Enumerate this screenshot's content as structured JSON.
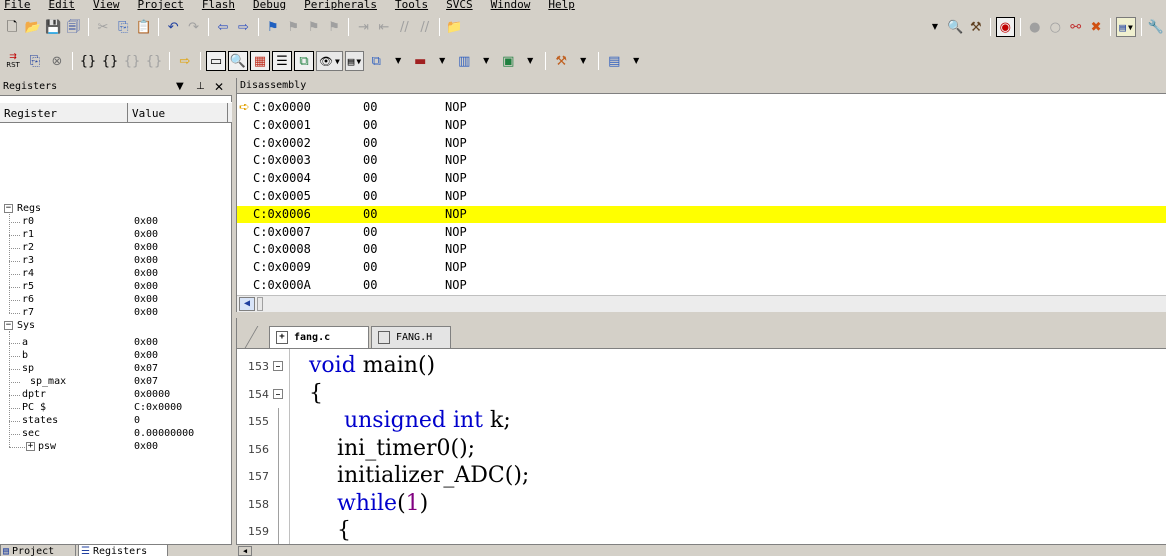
{
  "menu": [
    "File",
    "Edit",
    "View",
    "Project",
    "Flash",
    "Debug",
    "Peripherals",
    "Tools",
    "SVCS",
    "Window",
    "Help"
  ],
  "toolbar": {
    "reset_label": "RST",
    "inline_dropdown_label": "E"
  },
  "registers": {
    "title": "Registers",
    "col_register": "Register",
    "col_value": "Value",
    "regs_label": "Regs",
    "regs": [
      {
        "name": "r0",
        "value": "0x00"
      },
      {
        "name": "r1",
        "value": "0x00"
      },
      {
        "name": "r2",
        "value": "0x00"
      },
      {
        "name": "r3",
        "value": "0x00"
      },
      {
        "name": "r4",
        "value": "0x00"
      },
      {
        "name": "r5",
        "value": "0x00"
      },
      {
        "name": "r6",
        "value": "0x00"
      },
      {
        "name": "r7",
        "value": "0x00"
      }
    ],
    "sys_label": "Sys",
    "sys": [
      {
        "name": "a",
        "value": "0x00"
      },
      {
        "name": "b",
        "value": "0x00"
      },
      {
        "name": "sp",
        "value": "0x07"
      },
      {
        "name": "sp_max",
        "value": "0x07"
      },
      {
        "name": "dptr",
        "value": "0x0000"
      },
      {
        "name": "PC  $",
        "value": "C:0x0000"
      },
      {
        "name": "states",
        "value": "0"
      },
      {
        "name": "sec",
        "value": "0.00000000"
      },
      {
        "name": "psw",
        "value": "0x00"
      }
    ],
    "tabs": [
      "Project",
      "Registers"
    ]
  },
  "disassembly": {
    "title": "Disassembly",
    "rows": [
      {
        "addr": "C:0x0000",
        "op": "00",
        "mnem": "NOP"
      },
      {
        "addr": "C:0x0001",
        "op": "00",
        "mnem": "NOP"
      },
      {
        "addr": "C:0x0002",
        "op": "00",
        "mnem": "NOP"
      },
      {
        "addr": "C:0x0003",
        "op": "00",
        "mnem": "NOP"
      },
      {
        "addr": "C:0x0004",
        "op": "00",
        "mnem": "NOP"
      },
      {
        "addr": "C:0x0005",
        "op": "00",
        "mnem": "NOP"
      },
      {
        "addr": "C:0x0006",
        "op": "00",
        "mnem": "NOP"
      },
      {
        "addr": "C:0x0007",
        "op": "00",
        "mnem": "NOP"
      },
      {
        "addr": "C:0x0008",
        "op": "00",
        "mnem": "NOP"
      },
      {
        "addr": "C:0x0009",
        "op": "00",
        "mnem": "NOP"
      },
      {
        "addr": "C:0x000A",
        "op": "00",
        "mnem": "NOP"
      }
    ],
    "current_index": 0,
    "highlight_index": 6,
    "highlight_color": "#ffff00"
  },
  "editor": {
    "tabs": [
      "fang.c",
      "FANG.H"
    ],
    "lines": [
      {
        "n": "153",
        "fold": true,
        "parts": [
          {
            "t": "void",
            "c": "kw"
          },
          {
            "t": " main()",
            "c": ""
          }
        ]
      },
      {
        "n": "154",
        "fold": true,
        "parts": [
          {
            "t": "{",
            "c": ""
          }
        ]
      },
      {
        "n": "155",
        "fold": false,
        "parts": [
          {
            "t": "     unsigned int",
            "c": "kw"
          },
          {
            "t": " k;",
            "c": ""
          }
        ]
      },
      {
        "n": "156",
        "fold": false,
        "parts": [
          {
            "t": "    ini_timer0();",
            "c": ""
          }
        ]
      },
      {
        "n": "157",
        "fold": false,
        "parts": [
          {
            "t": "    initializer_ADC();",
            "c": ""
          }
        ]
      },
      {
        "n": "158",
        "fold": false,
        "parts": [
          {
            "t": "    while",
            "c": "kw"
          },
          {
            "t": "(",
            "c": ""
          },
          {
            "t": "1",
            "c": "num"
          },
          {
            "t": ")",
            "c": ""
          }
        ]
      },
      {
        "n": "159",
        "fold": false,
        "parts": [
          {
            "t": "    {",
            "c": ""
          }
        ]
      }
    ],
    "keyword_color": "#0000cc",
    "number_color": "#800080"
  }
}
